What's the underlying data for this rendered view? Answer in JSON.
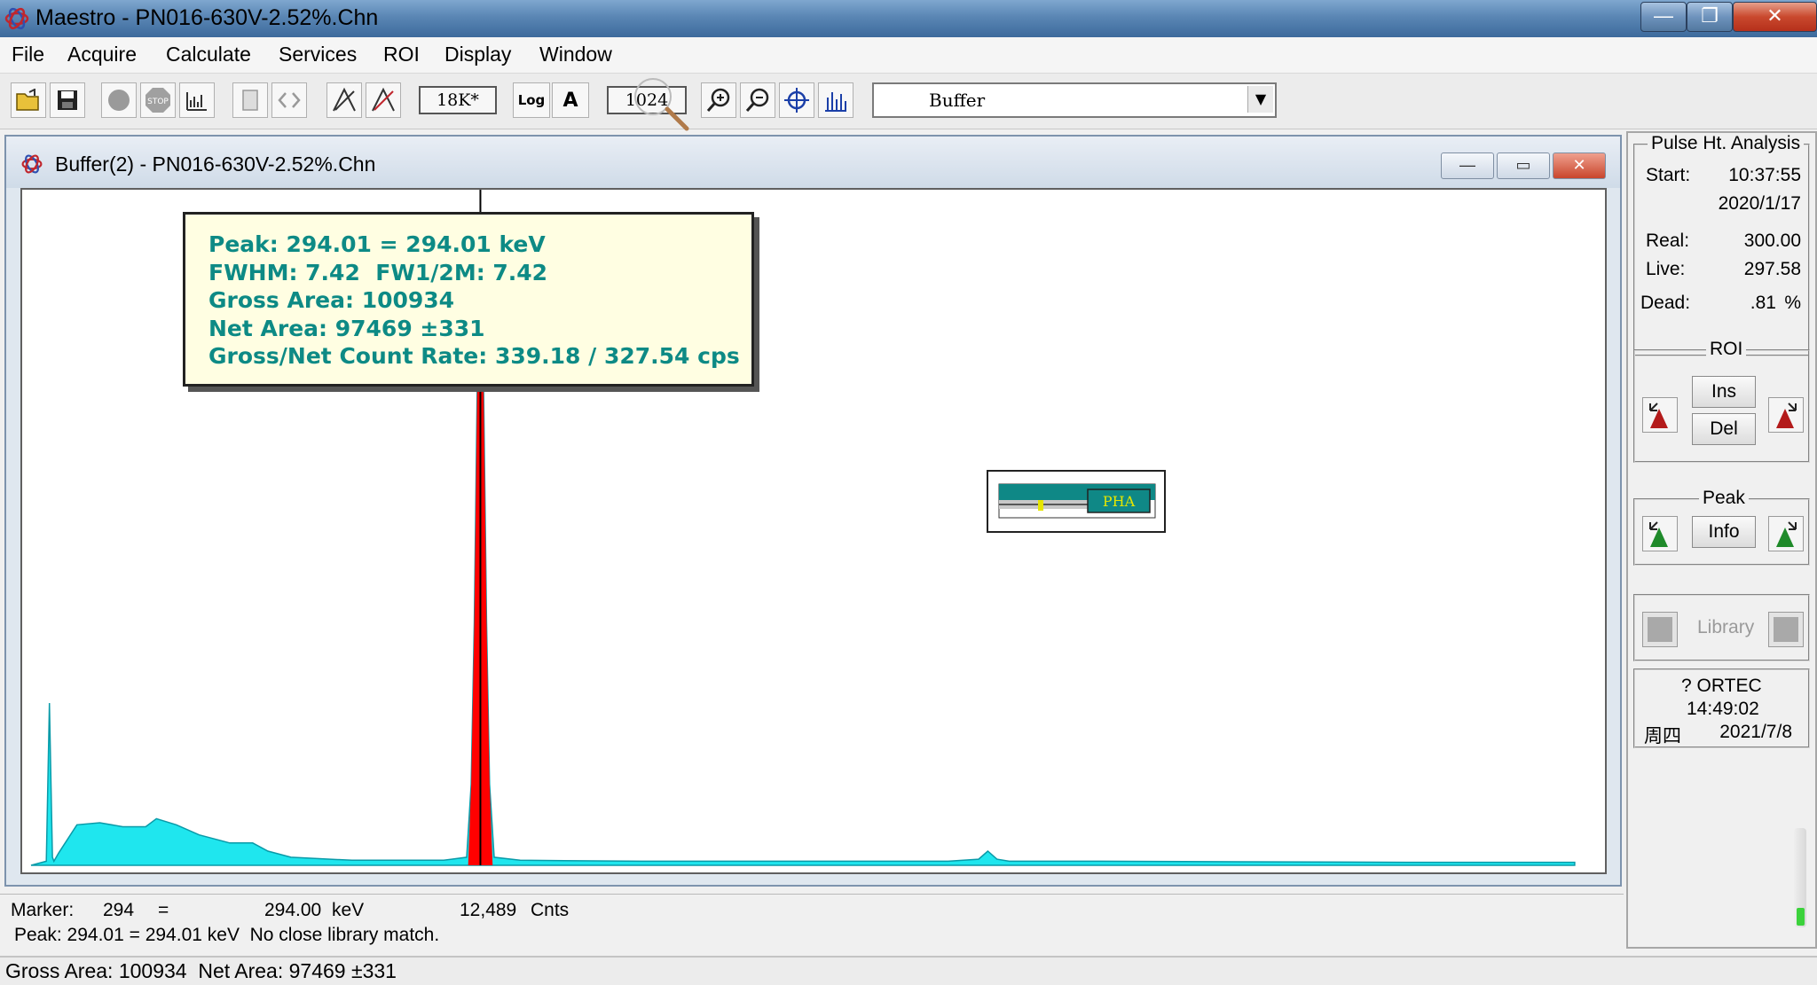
{
  "app": {
    "title": "Maestro - PN016-630V-2.52%.Chn"
  },
  "window_controls": {
    "minimize": "—",
    "maximize": "❐",
    "close": "✕"
  },
  "menu": [
    "File",
    "Acquire",
    "Calculate",
    "Services",
    "ROI",
    "Display",
    "Window"
  ],
  "toolbar": {
    "memory_label": "18K*",
    "log_label": "Log",
    "auto_label": "A",
    "scale_value": "1024",
    "detector_select": "Buffer",
    "icons": [
      "open-folder-icon",
      "save-disk-icon",
      "start-acquire-icon",
      "stop-icon",
      "copy-to-buffer-icon",
      "clear-icon",
      "roi-arrows-icon",
      "mark-peak-icon",
      "unmark-peak-icon",
      "zoom-in-icon",
      "zoom-out-icon",
      "center-icon",
      "fullview-icon"
    ]
  },
  "buffer_window": {
    "title": "Buffer(2) - PN016-630V-2.52%.Chn"
  },
  "peak_popup": {
    "lines": [
      "Peak: 294.01 = 294.01 keV",
      "FWHM: 7.42  FW1/2M: 7.42",
      "Gross Area: 100934",
      "Net Area: 97469 ±331",
      "Gross/Net Count Rate: 339.18 / 327.54 cps"
    ]
  },
  "pha_widget": {
    "label": "PHA"
  },
  "status": {
    "marker_label": "Marker:",
    "marker_channel": "294",
    "equals": "=",
    "marker_energy": "294.00",
    "energy_unit": "keV",
    "counts": "12,489",
    "counts_unit": "Cnts",
    "peak_line": "Peak: 294.01 = 294.01 keV  No close library match.",
    "bottom_line": "Gross Area: 100934  Net Area: 97469 ±331"
  },
  "right_panel": {
    "pha_title": "Pulse Ht. Analysis",
    "start_label": "Start:",
    "start_time": "10:37:55",
    "start_date": "2020/1/17",
    "real_label": "Real:",
    "real_value": "300.00",
    "live_label": "Live:",
    "live_value": "297.58",
    "dead_label": "Dead:",
    "dead_value": ".81",
    "dead_unit": "%",
    "roi_title": "ROI",
    "ins_label": "Ins",
    "del_label": "Del",
    "peak_title": "Peak",
    "info_label": "Info",
    "library_label": "Library",
    "ortec_label": "? ORTEC",
    "clock_time": "14:49:02",
    "clock_weekday": "周四",
    "clock_date": "2021/7/8"
  },
  "colors": {
    "spectrum_fill": "#1fe6ee",
    "roi_peak_fill": "#ff0000",
    "popup_text": "#0d8a85",
    "popup_bg": "#fffee2"
  },
  "chart_data": {
    "type": "area",
    "title": "",
    "xlabel": "",
    "ylabel": "",
    "x": [
      0,
      10,
      12,
      14,
      15,
      18,
      30,
      45,
      60,
      75,
      82,
      95,
      110,
      130,
      145,
      155,
      170,
      210,
      270,
      285,
      288,
      290,
      292,
      294,
      296,
      298,
      300,
      303,
      320,
      400,
      600,
      620,
      626,
      632,
      640,
      700,
      900,
      1010
    ],
    "values": [
      0,
      4,
      160,
      8,
      4,
      12,
      40,
      42,
      38,
      38,
      46,
      40,
      30,
      22,
      22,
      14,
      8,
      5,
      5,
      8,
      80,
      240,
      480,
      620,
      480,
      240,
      80,
      8,
      5,
      4,
      4,
      6,
      14,
      6,
      4,
      4,
      3,
      3
    ],
    "roi": {
      "start": 286,
      "end": 302,
      "peak": 294
    }
  }
}
